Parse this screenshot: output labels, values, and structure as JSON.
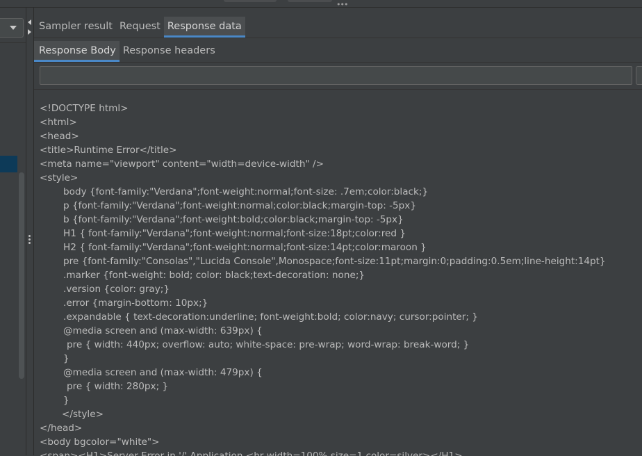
{
  "tabs_primary": [
    {
      "label": "Sampler result",
      "active": false
    },
    {
      "label": "Request",
      "active": false
    },
    {
      "label": "Response data",
      "active": true
    }
  ],
  "tabs_secondary": [
    {
      "label": "Response Body",
      "active": true
    },
    {
      "label": "Response headers",
      "active": false
    }
  ],
  "search": {
    "value": "",
    "placeholder": ""
  },
  "response_body": {
    "lines": [
      "<!DOCTYPE html>",
      "<html>",
      "<head>",
      "<title>Runtime Error</title>",
      "<meta name=\"viewport\" content=\"width=device-width\" />",
      "<style>",
      "body {font-family:\"Verdana\";font-weight:normal;font-size: .7em;color:black;}",
      "p {font-family:\"Verdana\";font-weight:normal;color:black;margin-top: -5px}",
      "b {font-family:\"Verdana\";font-weight:bold;color:black;margin-top: -5px}",
      "H1 { font-family:\"Verdana\";font-weight:normal;font-size:18pt;color:red }",
      "H2 { font-family:\"Verdana\";font-weight:normal;font-size:14pt;color:maroon }",
      "pre {font-family:\"Consolas\",\"Lucida Console\",Monospace;font-size:11pt;margin:0;padding:0.5em;line-height:14pt}",
      ".marker {font-weight: bold; color: black;text-decoration: none;}",
      ".version {color: gray;}",
      ".error {margin-bottom: 10px;}",
      ".expandable { text-decoration:underline; font-weight:bold; color:navy; cursor:pointer; }",
      "@media screen and (max-width: 639px) {",
      "pre { width: 440px; overflow: auto; white-space: pre-wrap; word-wrap: break-word; }",
      "}",
      "@media screen and (max-width: 479px) {",
      "pre { width: 280px; }",
      "}",
      "</style>",
      "</head>",
      "<body bgcolor=\"white\">",
      "<span><H1>Server Error in '/' Application.<hr width=100% size=1 color=silver></H1>"
    ]
  },
  "colors": {
    "background": "#3c3f41",
    "text": "#bbbbbb",
    "tab_active_underline": "#4a88c7",
    "selection": "#0d3a58"
  },
  "icons": [
    "chevron-down-icon",
    "collapse-left-icon",
    "expand-right-icon",
    "drag-handle-icon",
    "more-dots-icon"
  ]
}
